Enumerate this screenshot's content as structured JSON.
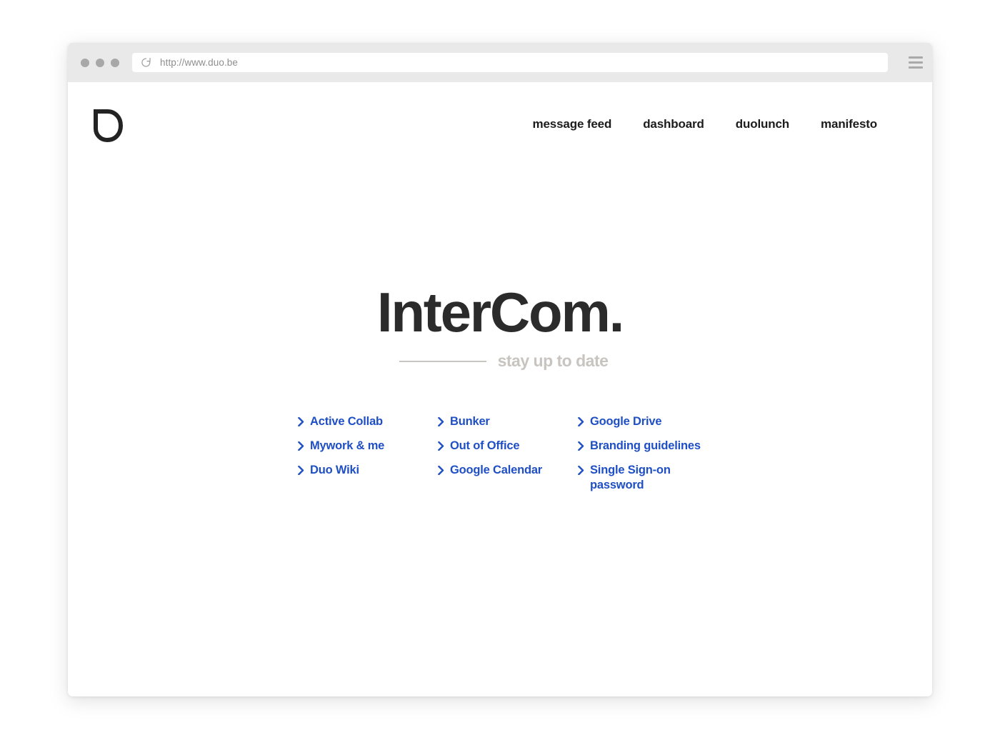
{
  "browser": {
    "url": "http://www.duo.be",
    "reload_icon": "reload-icon",
    "menu_icon": "hamburger-menu-icon",
    "traffic_lights": [
      "close-dot",
      "minimize-dot",
      "maximize-dot"
    ]
  },
  "site": {
    "logo_icon": "duo-d-logo-icon",
    "nav": [
      {
        "label": "message feed"
      },
      {
        "label": "dashboard"
      },
      {
        "label": "duolunch"
      },
      {
        "label": "manifesto"
      }
    ]
  },
  "hero": {
    "title": "InterCom.",
    "subtitle": "stay up to date"
  },
  "links": {
    "columns": [
      {
        "items": [
          {
            "label": "Active Collab"
          },
          {
            "label": "Mywork & me"
          },
          {
            "label": "Duo Wiki"
          }
        ]
      },
      {
        "items": [
          {
            "label": "Bunker"
          },
          {
            "label": "Out of Office"
          },
          {
            "label": "Google Calendar"
          }
        ]
      },
      {
        "items": [
          {
            "label": "Google Drive"
          },
          {
            "label": "Branding guidelines"
          },
          {
            "label": "Single Sign-on password"
          }
        ]
      }
    ]
  },
  "colors": {
    "link_blue": "#1f4fc4",
    "title_dark": "#2b2b2b",
    "subtitle_gray": "#c8c5c0",
    "chrome_gray": "#e9e9e9"
  }
}
